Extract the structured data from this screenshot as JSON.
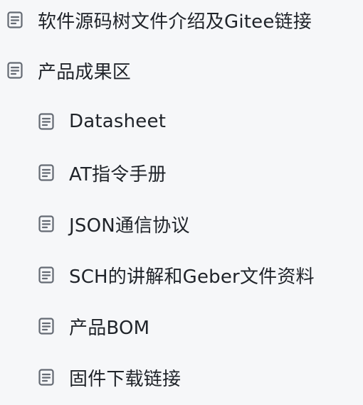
{
  "doc_tree": {
    "items": [
      {
        "label": "软件源码树文件介绍及Gitee链接",
        "icon": "document-icon"
      },
      {
        "label": "产品成果区",
        "icon": "document-icon"
      },
      {
        "label": "Datasheet",
        "icon": "document-icon"
      },
      {
        "label": "AT指令手册",
        "icon": "document-icon"
      },
      {
        "label": "JSON通信协议",
        "icon": "document-icon"
      },
      {
        "label": "SCH的讲解和Geber文件资料",
        "icon": "document-icon"
      },
      {
        "label": "产品BOM",
        "icon": "document-icon"
      },
      {
        "label": "固件下载链接",
        "icon": "document-icon"
      }
    ]
  },
  "colors": {
    "background": "#f6f7f9",
    "text": "#1f2329",
    "icon": "#646a73"
  }
}
